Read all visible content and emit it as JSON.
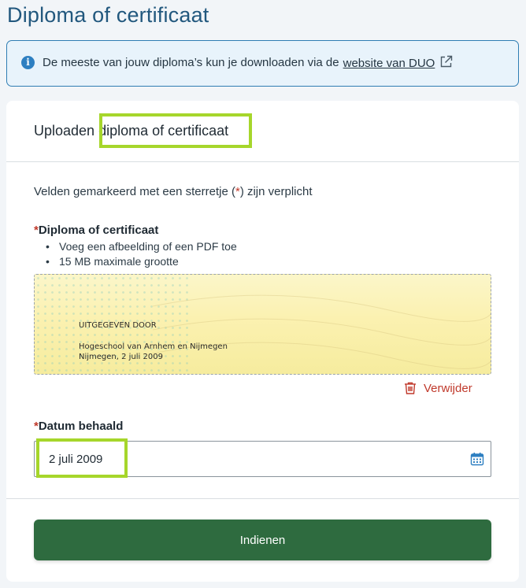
{
  "page": {
    "title": "Diploma of certificaat"
  },
  "info": {
    "text": "De meeste van jouw diploma’s kun je downloaden via de",
    "link_text": "website van DUO",
    "icon": "info-icon",
    "link_icon": "external-link-icon"
  },
  "card": {
    "title_plain": "Uploaden",
    "title_highlight": "diploma of certificaat",
    "required_note_pre": "Velden gemarkeerd met een sterretje (",
    "required_star": "*",
    "required_note_post": ") zijn verplicht"
  },
  "upload_field": {
    "star": "*",
    "label": "Diploma of certificaat",
    "hints": [
      "Voeg een afbeelding of een PDF toe",
      "15 MB maximale grootte"
    ],
    "preview": {
      "issued_by_label": "UITGEGEVEN DOOR",
      "institution": "Hogeschool van Arnhem en Nijmegen",
      "place_date": "Nijmegen, 2 juli 2009"
    },
    "remove_label": "Verwijder",
    "remove_icon": "trash-icon"
  },
  "date_field": {
    "star": "*",
    "label": "Datum behaald",
    "value": "2 juli 2009",
    "icon": "calendar-icon"
  },
  "submit": {
    "label": "Indienen"
  },
  "colors": {
    "accent": "#22587e",
    "highlight": "#a6d62b",
    "submit": "#2e6b3f",
    "danger": "#c0392b"
  }
}
